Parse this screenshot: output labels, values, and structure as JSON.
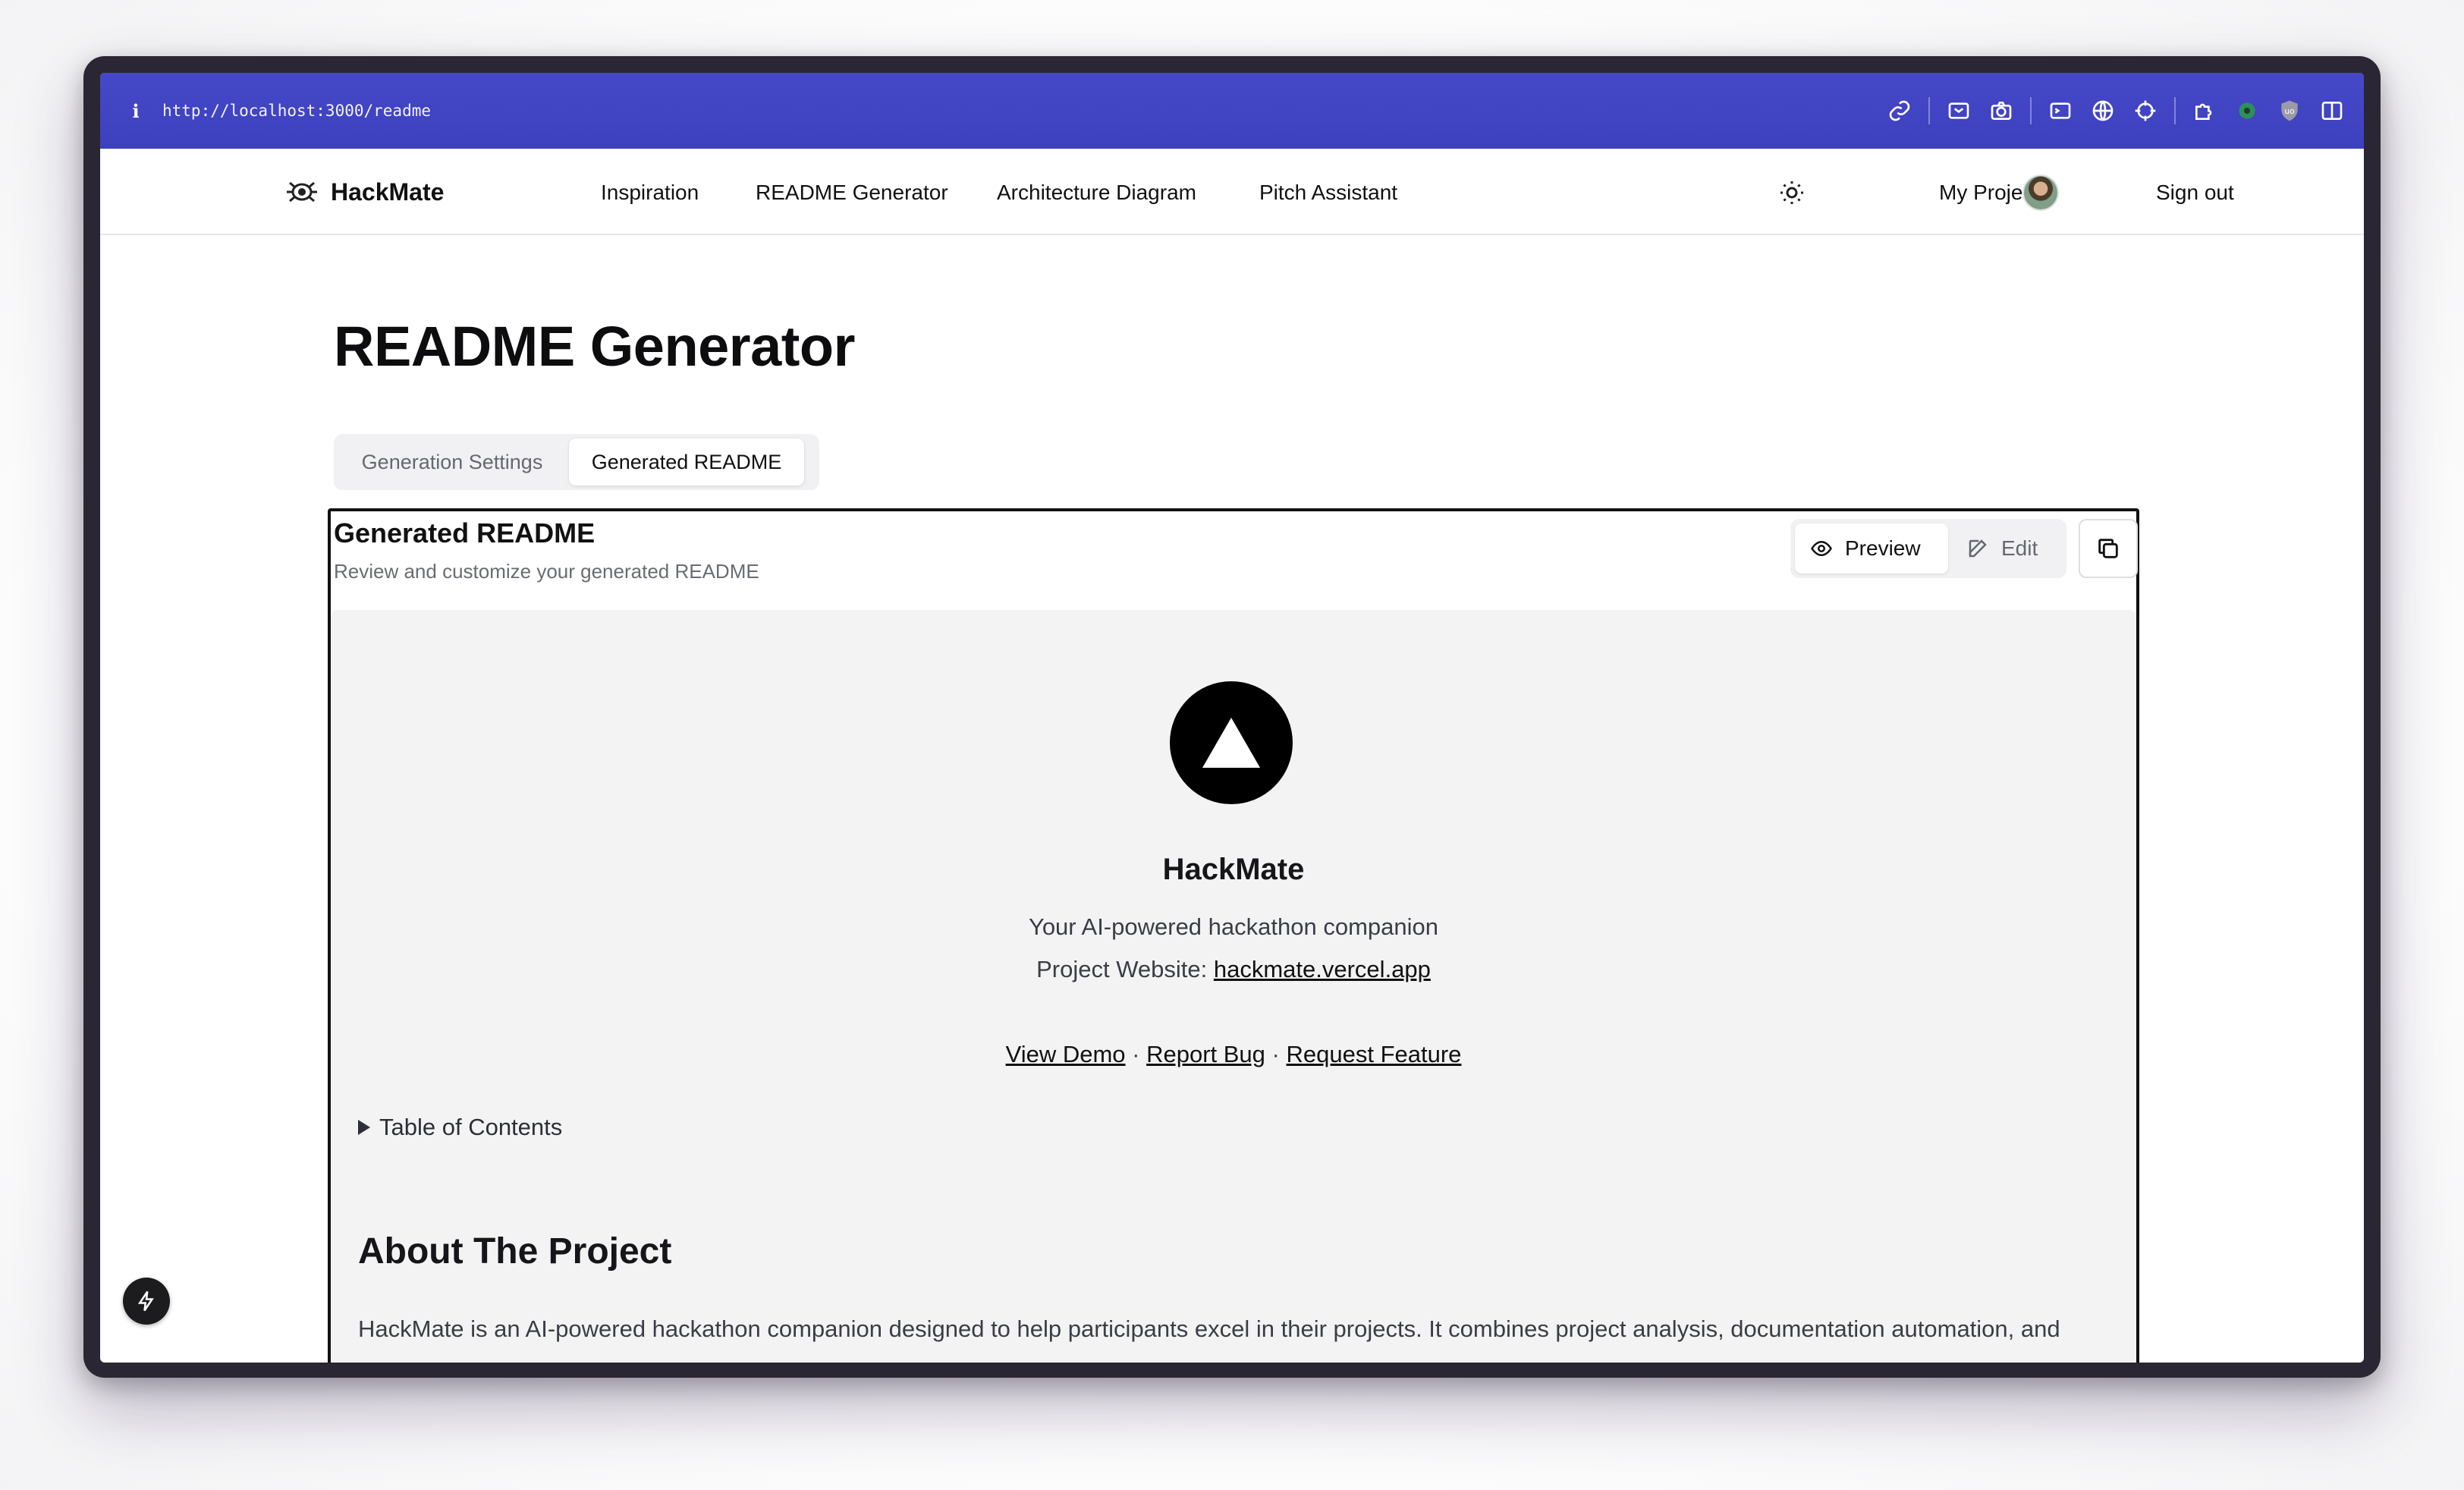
{
  "browser": {
    "url": "http://localhost:3000/readme",
    "info_glyph": "i",
    "toolbar_icons": [
      "link-icon",
      "inbox-icon",
      "camera-icon",
      "terminal-icon",
      "globe-icon",
      "crosshair-icon",
      "puzzle-icon",
      "extension-icon",
      "shield-icon",
      "sidebar-icon"
    ]
  },
  "nav": {
    "brand": "HackMate",
    "links": [
      "Inspiration",
      "README Generator",
      "Architecture Diagram",
      "Pitch Assistant"
    ],
    "my_projects": "My Projects",
    "sign_out": "Sign out"
  },
  "page": {
    "title": "README Generator",
    "tabs": [
      "Generation Settings",
      "Generated README"
    ],
    "active_tab": "Generated README"
  },
  "card": {
    "title": "Generated README",
    "subtitle": "Review and customize your generated README",
    "preview_label": "Preview",
    "edit_label": "Edit"
  },
  "readme": {
    "project_name": "HackMate",
    "tagline": "Your AI-powered hackathon companion",
    "website_prefix": "Project Website:",
    "website_link": "hackmate.vercel.app",
    "links": [
      "View Demo",
      "Report Bug",
      "Request Feature"
    ],
    "separator": "·",
    "toc_label": "Table of Contents",
    "about_heading": "About The Project",
    "about_text": "HackMate is an AI-powered hackathon companion designed to help participants excel in their projects. It combines project analysis, documentation automation, and pitch optimization to give teams a competitive edge."
  },
  "colors": {
    "url_bar": "#4548c7",
    "accent": "#111111",
    "preview_bg": "#f3f3f4"
  }
}
